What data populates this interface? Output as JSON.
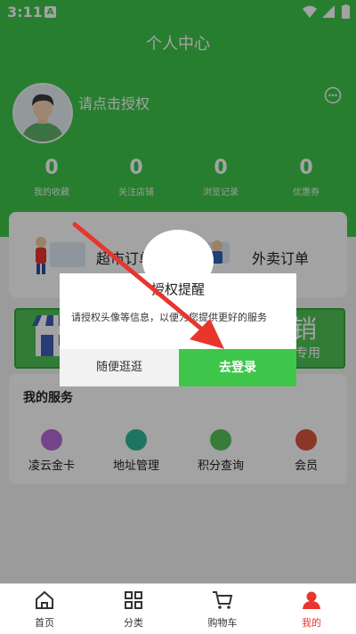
{
  "status": {
    "time": "3:11",
    "app_badge": "A"
  },
  "header": {
    "title": "个人中心"
  },
  "profile": {
    "login_hint": "请点击授权"
  },
  "stats": [
    {
      "value": "0",
      "label": "我的收藏"
    },
    {
      "value": "0",
      "label": "关注店铺"
    },
    {
      "value": "0",
      "label": "浏览记录"
    },
    {
      "value": "0",
      "label": "优惠券"
    }
  ],
  "orders": {
    "supermarket": "超市订单",
    "takeout": "外卖订单"
  },
  "banner": {
    "text": "销",
    "sub": "专用"
  },
  "services": {
    "title": "我的服务",
    "items": [
      {
        "label": "凌云金卡",
        "color": "#b66ad8"
      },
      {
        "label": "地址管理",
        "color": "#2fb79a"
      },
      {
        "label": "积分查询",
        "color": "#56c45a"
      },
      {
        "label": "会员",
        "color": "#d9573e"
      }
    ]
  },
  "dialog": {
    "title": "授权提醒",
    "message": "请授权头像等信息，以便为您提供更好的服务",
    "browse_label": "随便逛逛",
    "login_label": "去登录"
  },
  "tabbar": [
    {
      "label": "首页",
      "active": false
    },
    {
      "label": "分类",
      "active": false
    },
    {
      "label": "购物车",
      "active": false
    },
    {
      "label": "我的",
      "active": true
    }
  ],
  "colors": {
    "accent": "#3ec64a",
    "active_tab": "#e8352d",
    "arrow": "#e8352d"
  }
}
